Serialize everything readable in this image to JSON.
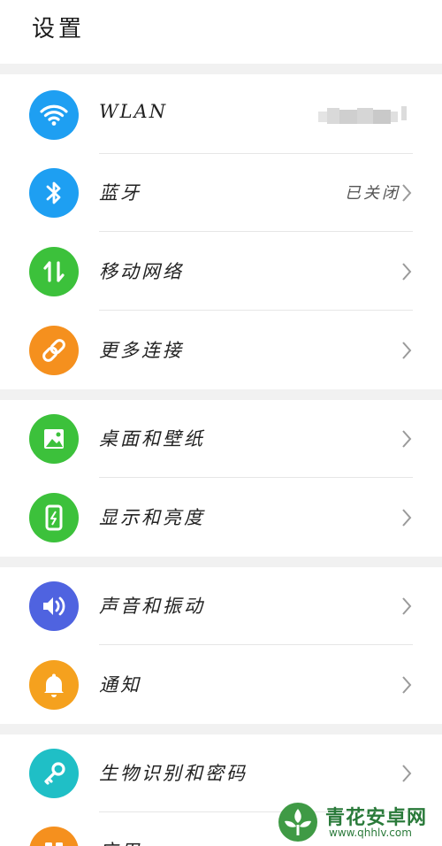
{
  "header": {
    "title": "设置"
  },
  "groups": [
    {
      "items": [
        {
          "label": "WLAN",
          "value": "",
          "icon": "wifi-icon",
          "color": "#1E9FF2"
        },
        {
          "label": "蓝牙",
          "value": "已关闭",
          "icon": "bluetooth-icon",
          "color": "#1E9FF2"
        },
        {
          "label": "移动网络",
          "value": "",
          "icon": "mobile-data-icon",
          "color": "#3CC13B"
        },
        {
          "label": "更多连接",
          "value": "",
          "icon": "link-icon",
          "color": "#F5901E"
        }
      ]
    },
    {
      "items": [
        {
          "label": "桌面和壁纸",
          "value": "",
          "icon": "wallpaper-icon",
          "color": "#3CC13B"
        },
        {
          "label": "显示和亮度",
          "value": "",
          "icon": "display-brightness-icon",
          "color": "#3CC13B"
        }
      ]
    },
    {
      "items": [
        {
          "label": "声音和振动",
          "value": "",
          "icon": "sound-icon",
          "color": "#4F63E0"
        },
        {
          "label": "通知",
          "value": "",
          "icon": "bell-icon",
          "color": "#F5A11E"
        }
      ]
    },
    {
      "items": [
        {
          "label": "生物识别和密码",
          "value": "",
          "icon": "key-icon",
          "color": "#1FBFC6"
        },
        {
          "label": "应用",
          "value": "",
          "icon": "apps-icon",
          "color": "#F5901E"
        }
      ]
    }
  ],
  "watermark": {
    "title": "青花安卓网",
    "url": "www.qhhlv.com"
  }
}
